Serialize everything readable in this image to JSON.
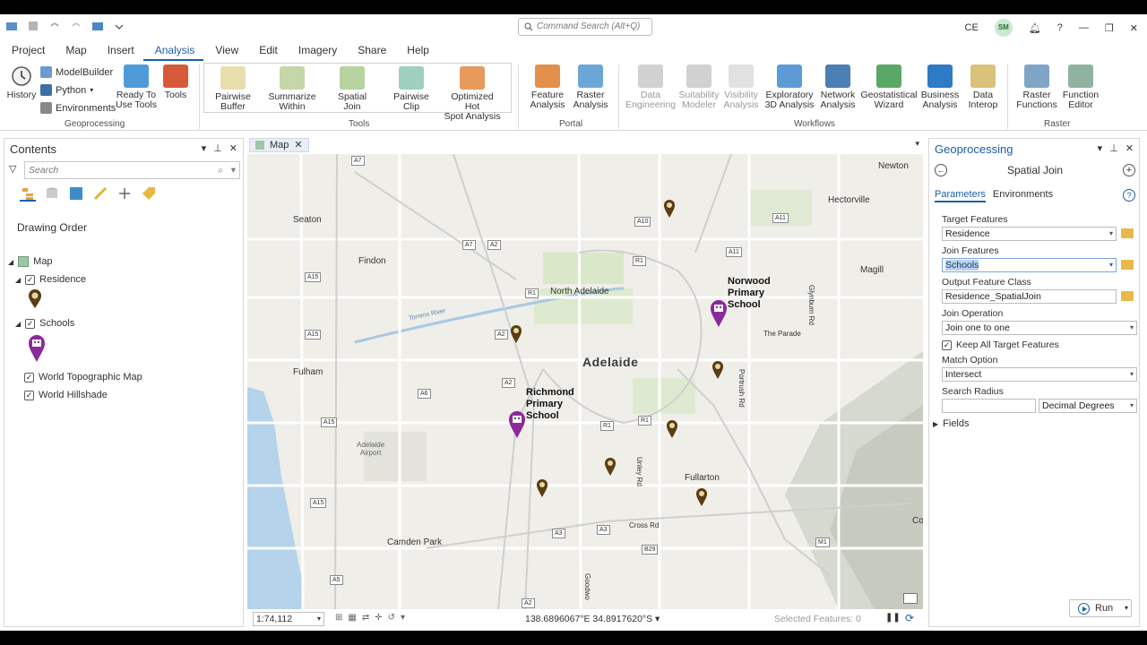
{
  "titlebar": {
    "command_search_placeholder": "Command Search (Alt+Q)",
    "user_initials": "CE",
    "avatar_initials": "SM"
  },
  "ribbon_tabs": [
    "Project",
    "Map",
    "Insert",
    "Analysis",
    "View",
    "Edit",
    "Imagery",
    "Share",
    "Help"
  ],
  "active_tab": "Analysis",
  "ribbon": {
    "geoprocessing": {
      "label": "Geoprocessing",
      "history": "History",
      "modelbuilder": "ModelBuilder",
      "python": "Python",
      "environments": "Environments",
      "ready_to_use": [
        "Ready To",
        "Use Tools"
      ],
      "tools": "Tools"
    },
    "tools": {
      "label": "Tools",
      "items": [
        [
          "Pairwise",
          "Buffer"
        ],
        [
          "Summarize",
          "Within"
        ],
        [
          "Spatial",
          "Join"
        ],
        [
          "Pairwise",
          "Clip"
        ],
        [
          "Optimized Hot",
          "Spot Analysis"
        ]
      ]
    },
    "portal": {
      "label": "Portal",
      "items": [
        [
          "Feature",
          "Analysis"
        ],
        [
          "Raster",
          "Analysis"
        ]
      ]
    },
    "workflows": {
      "label": "Workflows",
      "items": [
        [
          "Data",
          "Engineering"
        ],
        [
          "Suitability",
          "Modeler"
        ],
        [
          "Visibility",
          "Analysis"
        ],
        [
          "Exploratory",
          "3D Analysis"
        ],
        [
          "Network",
          "Analysis"
        ],
        [
          "Geostatistical",
          "Wizard"
        ],
        [
          "Business",
          "Analysis"
        ],
        [
          "Data",
          "Interop"
        ]
      ]
    },
    "raster": {
      "label": "Raster",
      "items": [
        [
          "Raster",
          "Functions"
        ],
        [
          "Function",
          "Editor"
        ]
      ]
    }
  },
  "contents": {
    "title": "Contents",
    "search_placeholder": "Search",
    "drawing_order": "Drawing Order",
    "map": "Map",
    "layers": {
      "residence": "Residence",
      "schools": "Schools",
      "topo": "World Topographic Map",
      "hillshade": "World Hillshade"
    }
  },
  "map": {
    "tab": "Map",
    "places": {
      "newton": "Newton",
      "hectorville": "Hectorville",
      "seaton": "Seaton",
      "findon": "Findon",
      "magill": "Magill",
      "north_adelaide": "North Adelaide",
      "adelaide": "Adelaide",
      "fulham": "Fulham",
      "airport": [
        "Adelaide",
        "Airport"
      ],
      "fullarton": "Fullarton",
      "camden_park": "Camden Park",
      "the_parade": "The Parade",
      "portrush_rd": "Portrush Rd",
      "glynburn_rd": "Glynburn Rd",
      "unley_rd": "Unley Rd",
      "cross_rd": "Cross Rd",
      "goodwood_rd": "Goodwo",
      "torrens_river": "Torrens River",
      "co": "Co"
    },
    "school_labels": {
      "norwood": [
        "Norwood",
        "Primary",
        "School"
      ],
      "richmond": [
        "Richmond",
        "Primary",
        "School"
      ]
    },
    "shields": [
      "A7",
      "A10",
      "A11",
      "A7",
      "A2",
      "A11",
      "R1",
      "A15",
      "R1",
      "A2",
      "A15",
      "A2",
      "A6",
      "R1",
      "A15",
      "R1",
      "A15",
      "A3",
      "A3",
      "B29",
      "A5",
      "M1",
      "A2"
    ],
    "scale": "1:74,112",
    "coordinates": "138.6896067°E 34.8917620°S",
    "selected_features": "Selected Features: 0"
  },
  "geoprocessing": {
    "title": "Geoprocessing",
    "tool": "Spatial Join",
    "tabs": [
      "Parameters",
      "Environments"
    ],
    "target_features_label": "Target Features",
    "target_features": "Residence",
    "join_features_label": "Join Features",
    "join_features": "Schools",
    "output_label": "Output Feature Class",
    "output": "Residence_SpatialJoin",
    "join_operation_label": "Join Operation",
    "join_operation": "Join one to one",
    "keep_all": "Keep All Target Features",
    "match_option_label": "Match Option",
    "match_option": "Intersect",
    "search_radius_label": "Search Radius",
    "search_radius_value": "",
    "search_radius_unit": "Decimal Degrees",
    "fields": "Fields",
    "run": "Run"
  },
  "colors": {
    "accent": "#1a5fa8",
    "school_marker": "#8b2a9a",
    "residence_marker": "#5a3d12"
  }
}
